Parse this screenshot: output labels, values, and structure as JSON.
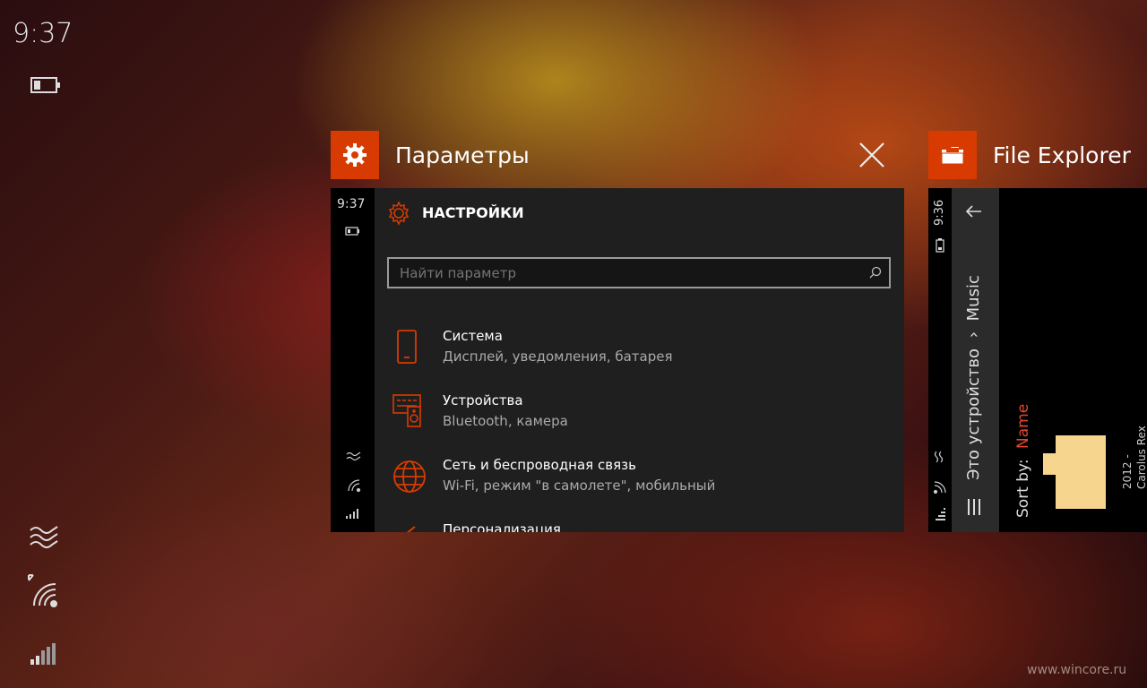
{
  "status": {
    "time": "9:37",
    "icons": [
      "battery-icon",
      "wind-icon",
      "wifi-icon",
      "signal-icon"
    ]
  },
  "cards": [
    {
      "app_title": "Параметры",
      "icon": "gear-icon",
      "screen": {
        "time": "9:37",
        "header": "НАСТРОЙКИ",
        "search_placeholder": "Найти параметр",
        "items": [
          {
            "icon": "phone-icon",
            "title": "Система",
            "subtitle": "Дисплей, уведомления, батарея"
          },
          {
            "icon": "devices-icon",
            "title": "Устройства",
            "subtitle": "Bluetooth, камера"
          },
          {
            "icon": "globe-icon",
            "title": "Сеть и беспроводная связь",
            "subtitle": "Wi-Fi, режим \"в самолете\", мобильный"
          },
          {
            "icon": "brush-icon",
            "title": "Персонализация",
            "subtitle": ""
          }
        ]
      }
    },
    {
      "app_title": "File Explorer",
      "icon": "folder-icon",
      "screen": {
        "time": "9:36",
        "breadcrumb_root": "Это устройство",
        "breadcrumb_sep": "›",
        "breadcrumb_current": "Music",
        "sort_label": "Sort by:",
        "sort_value": "Name",
        "item_line1": "2012 -",
        "item_line2": "Carolus Rex"
      }
    }
  ],
  "watermark": "www.wincore.ru",
  "colors": {
    "accent": "#d83b01",
    "thumb_bg": "#1f1f1f",
    "folder": "#f6d68f"
  }
}
